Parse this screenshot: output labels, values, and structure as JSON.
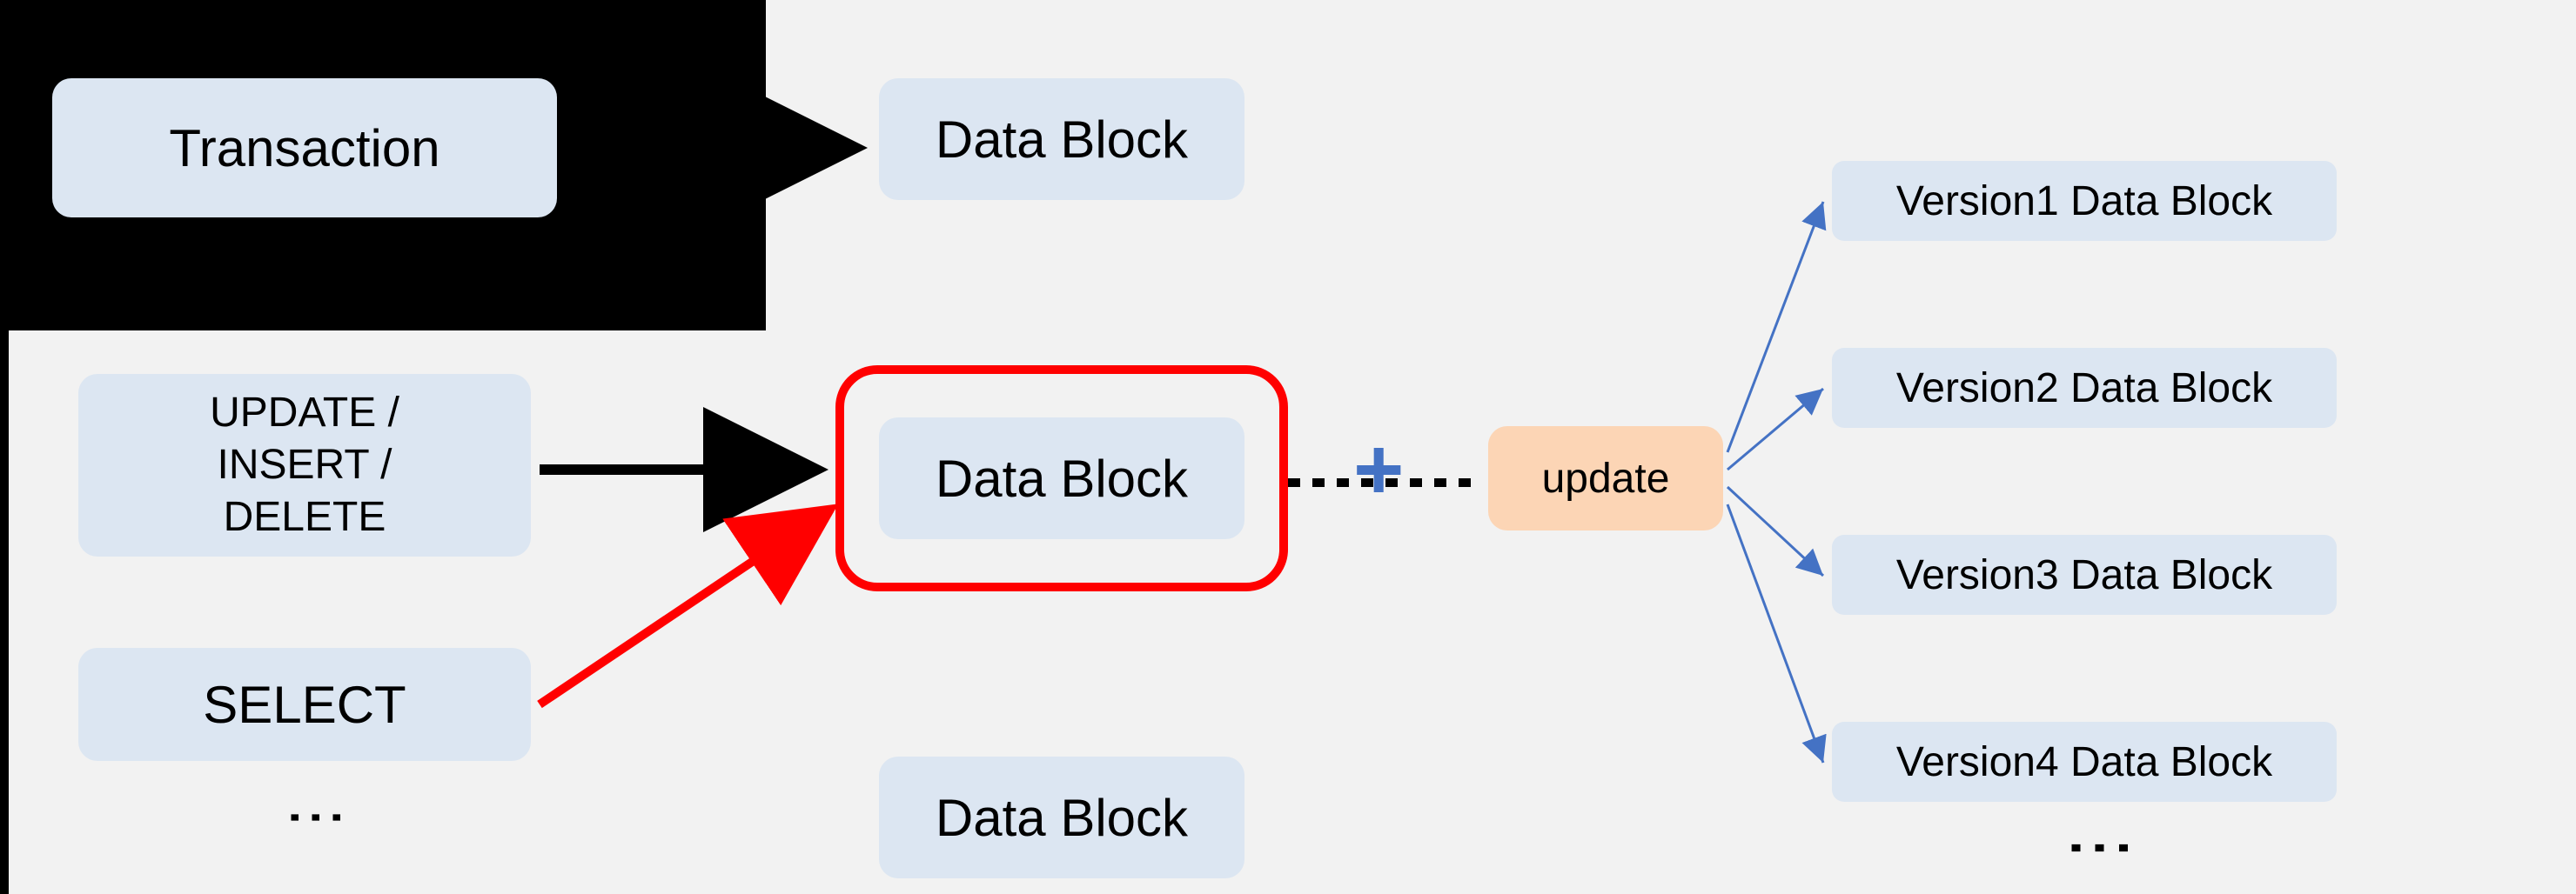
{
  "left": {
    "transaction": "Transaction",
    "ops": "UPDATE /\nINSERT /\nDELETE",
    "select": "SELECT"
  },
  "center": {
    "block1": "Data Block",
    "block2": "Data Block",
    "block3": "Data Block"
  },
  "action": {
    "plus": "+",
    "update": "update"
  },
  "versions": {
    "v1": "Version1 Data Block",
    "v2": "Version2 Data Block",
    "v3": "Version3 Data Block",
    "v4": "Version4 Data Block"
  }
}
